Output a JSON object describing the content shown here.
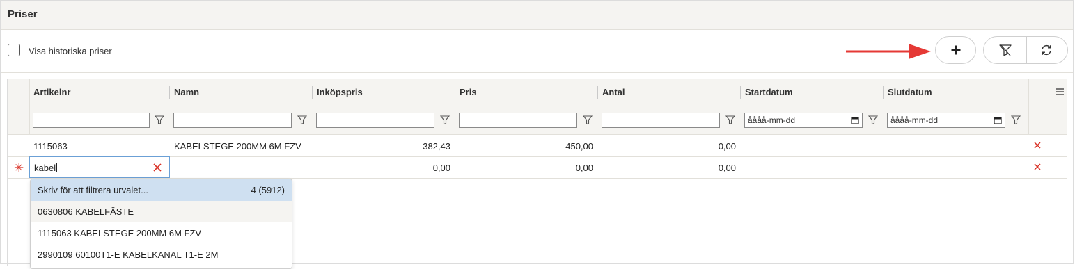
{
  "panel": {
    "title": "Priser"
  },
  "toolbar": {
    "show_history_label": "Visa historiska priser",
    "show_history_checked": false,
    "add_button_icon": "plus-icon",
    "clear_filter_icon": "filter-off-icon",
    "refresh_icon": "refresh-icon",
    "arrow_color": "#e53935"
  },
  "grid": {
    "columns": [
      "Artikelnr",
      "Namn",
      "Inköpspris",
      "Pris",
      "Antal",
      "Startdatum",
      "Slutdatum"
    ],
    "date_placeholder": "åååå-mm-dd",
    "rows": [
      {
        "artikelnr": "1115063",
        "namn": "KABELSTEGE 200MM 6M FZV",
        "inkopspris": "382,43",
        "pris": "450,00",
        "antal": "0,00"
      }
    ],
    "new_row": {
      "artikelnr_input": "kabel",
      "inkopspris": "0,00",
      "pris": "0,00",
      "antal": "0,00"
    }
  },
  "dropdown": {
    "hint": "Skriv för att filtrera urvalet...",
    "count": "4 (5912)",
    "items": [
      "0630806 KABELFÄSTE",
      "1115063 KABELSTEGE 200MM 6M FZV",
      "2990109 60100T1-E KABELKANAL T1-E 2M"
    ]
  },
  "colors": {
    "accent": "#6ba0d6",
    "danger": "#d93025",
    "highlight": "#cfe0f1"
  }
}
